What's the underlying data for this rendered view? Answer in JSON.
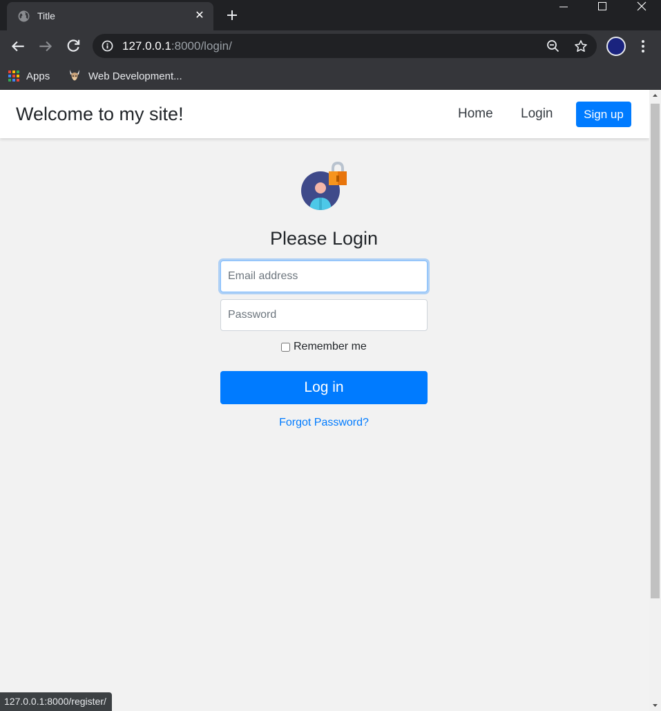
{
  "browser": {
    "tab_title": "Title",
    "url_host": "127.0.0.1",
    "url_path": ":8000/login/",
    "bookmarks": [
      {
        "label": "Apps",
        "icon": "apps-grid-icon"
      },
      {
        "label": "Web Development...",
        "icon": "viking-favicon-icon"
      }
    ],
    "status_url": "127.0.0.1:8000/register/"
  },
  "navbar": {
    "brand": "Welcome to my site!",
    "links": [
      "Home",
      "Login"
    ],
    "signup_label": "Sign up"
  },
  "login": {
    "title": "Please Login",
    "email_placeholder": "Email address",
    "password_placeholder": "Password",
    "remember_label": "Remember me",
    "submit_label": "Log in",
    "forgot_label": "Forgot Password?"
  },
  "colors": {
    "primary": "#007bff",
    "page_bg": "#f2f2f2",
    "chrome_dark": "#202124",
    "chrome_toolbar": "#35363a"
  }
}
